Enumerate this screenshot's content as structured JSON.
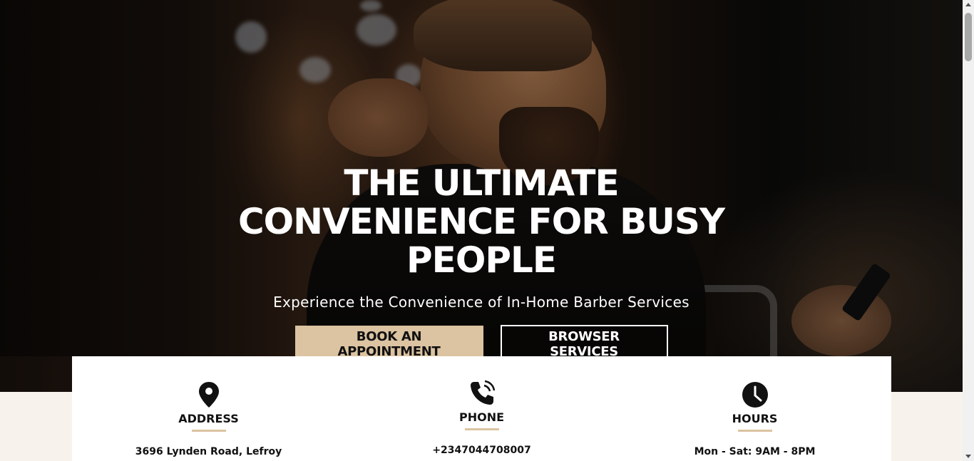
{
  "hero": {
    "title": "THE ULTIMATE CONVENIENCE FOR BUSY PEOPLE",
    "subtitle": "Experience the Convenience of In-Home Barber Services",
    "primary_button": "BOOK AN APPOINTMENT",
    "secondary_button": "BROWSER SERVICES",
    "background_image": "barber-cutting-hair-photo"
  },
  "info": {
    "address": {
      "icon": "map-pin-icon",
      "label": "ADDRESS",
      "value": "3696 Lynden Road, Lefroy"
    },
    "phone": {
      "icon": "phone-icon",
      "label": "PHONE",
      "value": "+2347044708007"
    },
    "hours": {
      "icon": "clock-icon",
      "label": "HOURS",
      "value": "Mon - Sat: 9AM - 8PM"
    }
  },
  "colors": {
    "accent": "#dcc3a1",
    "background": "#f7f3ec",
    "text": "#111111"
  }
}
